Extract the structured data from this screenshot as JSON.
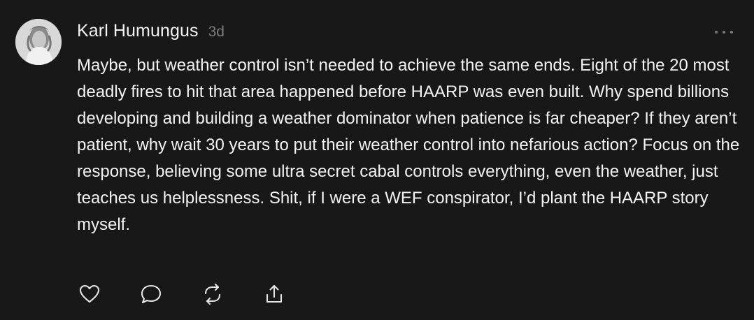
{
  "post": {
    "author": "Karl Humungus",
    "time_ago": "3d",
    "text": "Maybe, but weather control isn’t needed to achieve the same ends. Eight of the 20 most deadly fires to hit that area happened before HAARP was even built. Why spend billions developing and building a weather dominator when patience is far cheaper? If they aren’t patient, why wait 30 years to put their weather control into nefarious action? Focus on the response, believing some ultra secret cabal controls everything, even the weather, just teaches us helplessness. Shit, if I were a WEF conspirator, I’d plant the HAARP story myself."
  },
  "icons": {
    "more": "more-options-icon",
    "like": "heart-icon",
    "reply": "comment-bubble-icon",
    "repost": "repost-icon",
    "share": "share-icon"
  },
  "colors": {
    "background": "#181818",
    "primary_text": "#f3f3f3",
    "secondary_text": "#7d7d7d",
    "icon": "#e6e6e6"
  }
}
